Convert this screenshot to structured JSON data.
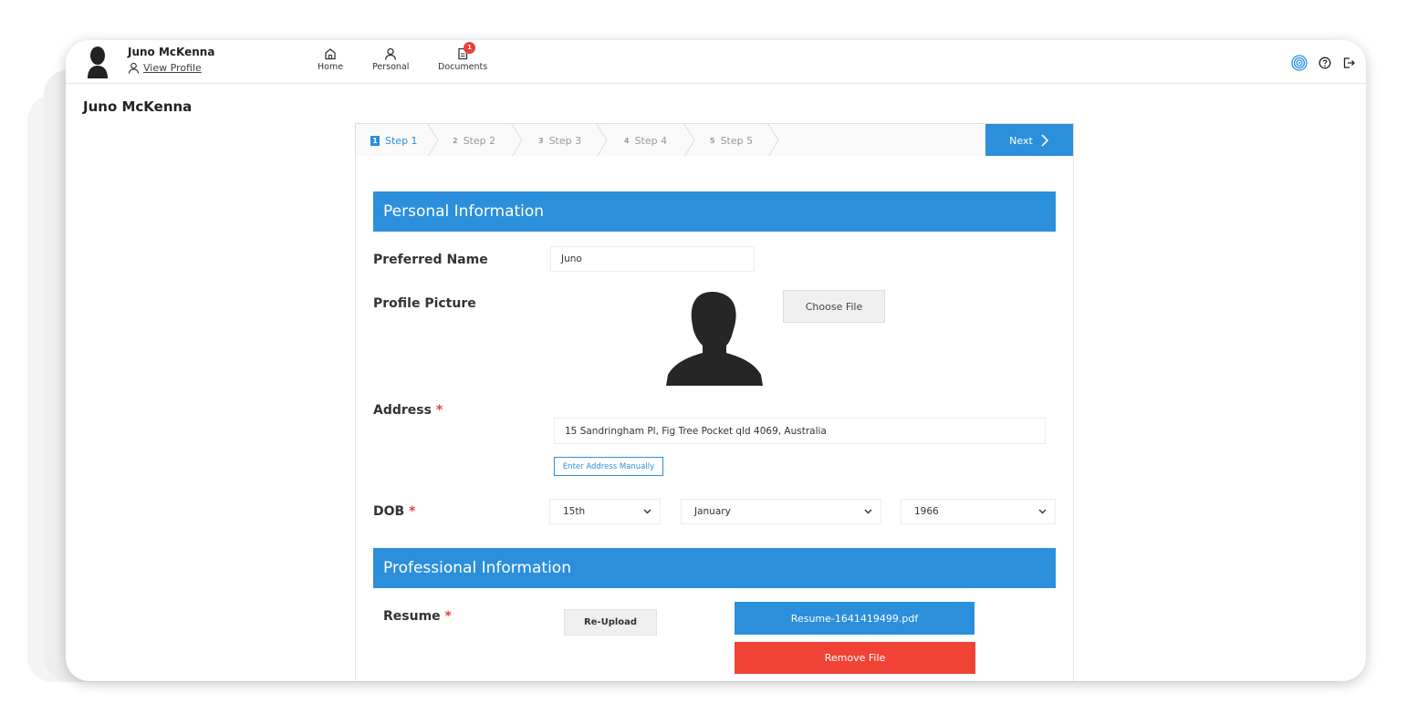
{
  "header": {
    "user_name": "Juno McKenna",
    "view_profile": "View Profile",
    "nav": [
      {
        "label": "Home",
        "icon": "home-icon"
      },
      {
        "label": "Personal",
        "icon": "user-icon"
      },
      {
        "label": "Documents",
        "icon": "document-icon",
        "badge": "1"
      }
    ],
    "icons": [
      "fingerprint-icon",
      "help-icon",
      "logout-icon"
    ]
  },
  "page": {
    "title": "Juno McKenna"
  },
  "stepper": {
    "steps": [
      {
        "num": "1",
        "label": "Step 1",
        "active": true
      },
      {
        "num": "2",
        "label": "Step 2"
      },
      {
        "num": "3",
        "label": "Step 3"
      },
      {
        "num": "4",
        "label": "Step 4"
      },
      {
        "num": "5",
        "label": "Step 5"
      }
    ],
    "next_label": "Next"
  },
  "personal": {
    "section_title": "Personal Information",
    "preferred_name_label": "Preferred Name",
    "preferred_name_value": "Juno",
    "profile_picture_label": "Profile Picture",
    "choose_file_label": "Choose File",
    "address_label": "Address",
    "address_value": "15 Sandringham Pl, Fig Tree Pocket qld 4069, Australia",
    "enter_manually_label": "Enter Address Manually",
    "dob_label": "DOB",
    "dob_day": "15th",
    "dob_month": "January",
    "dob_year": "1966",
    "required_mark": "*"
  },
  "professional": {
    "section_title": "Professional Information",
    "resume_label": "Resume",
    "reupload_label": "Re-Upload",
    "resume_file": "Resume-1641419499.pdf",
    "remove_file_label": "Remove File"
  },
  "colors": {
    "primary": "#2b8fdc",
    "danger": "#f04235"
  }
}
